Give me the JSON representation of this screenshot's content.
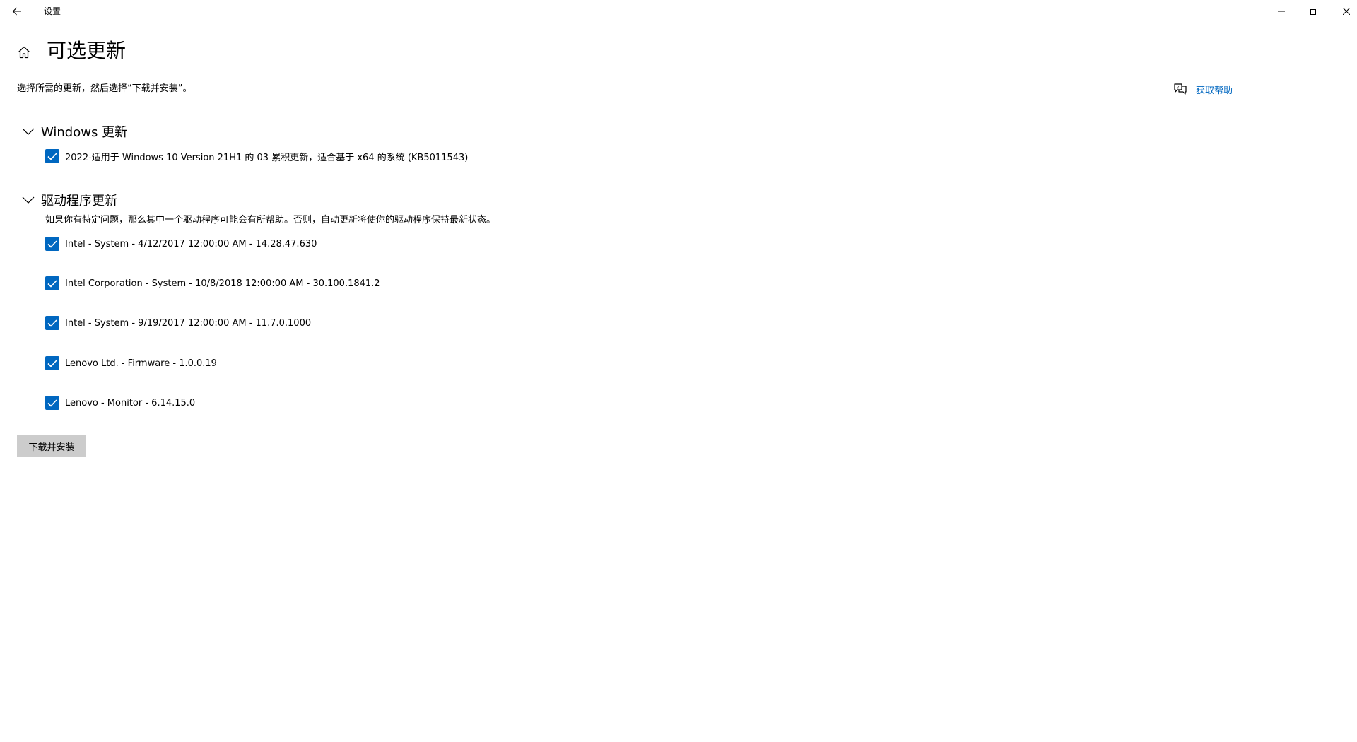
{
  "titlebar": {
    "title": "设置",
    "back_icon": "arrow-left-icon",
    "minimize_icon": "minimize-icon",
    "restore_icon": "restore-icon",
    "close_icon": "close-icon"
  },
  "header": {
    "home_icon": "home-icon",
    "title": "可选更新"
  },
  "description": "选择所需的更新，然后选择“下载并安装”。",
  "help": {
    "icon": "chat-help-icon",
    "label": "获取帮助"
  },
  "windows_section": {
    "title": "Windows 更新",
    "expanded": true,
    "items": [
      {
        "label": "2022-适用于 Windows 10 Version 21H1 的 03 累积更新，适合基于 x64 的系统 (KB5011543)",
        "checked": true
      }
    ]
  },
  "driver_section": {
    "title": "驱动程序更新",
    "expanded": true,
    "description": "如果你有特定问题，那么其中一个驱动程序可能会有所帮助。否则，自动更新将使你的驱动程序保持最新状态。",
    "items": [
      {
        "label": "Intel - System - 4/12/2017 12:00:00 AM - 14.28.47.630",
        "checked": true
      },
      {
        "label": "Intel Corporation - System - 10/8/2018 12:00:00 AM - 30.100.1841.2",
        "checked": true
      },
      {
        "label": "Intel - System - 9/19/2017 12:00:00 AM - 11.7.0.1000",
        "checked": true
      },
      {
        "label": "Lenovo Ltd. - Firmware - 1.0.0.19",
        "checked": true
      },
      {
        "label": "Lenovo - Monitor - 6.14.15.0",
        "checked": true
      }
    ]
  },
  "install_button": "下载并安装",
  "colors": {
    "accent": "#0067c0",
    "button_bg": "#cccccc",
    "background": "#ffffff"
  }
}
